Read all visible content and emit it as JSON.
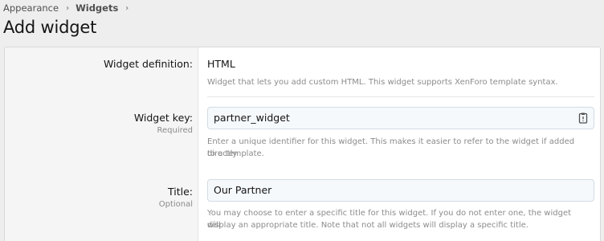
{
  "breadcrumb": {
    "items": [
      {
        "label": "Appearance"
      },
      {
        "label": "Widgets"
      }
    ]
  },
  "page_title": "Add widget",
  "form": {
    "definition": {
      "label": "Widget definition:",
      "value": "HTML",
      "hint": "Widget that lets you add custom HTML. This widget supports XenForo template syntax."
    },
    "widget_key": {
      "label": "Widget key:",
      "sublabel": "Required",
      "value": "partner_widget",
      "hint_line1": "Enter a unique identifier for this widget. This makes it easier to refer to the widget if added directly",
      "hint_line2": "to a template."
    },
    "title": {
      "label": "Title:",
      "sublabel": "Optional",
      "value": "Our Partner",
      "hint_line1": "You may choose to enter a specific title for this widget. If you do not enter one, the widget will",
      "hint_line2": "display an appropriate title. Note that not all widgets will display a specific title."
    }
  },
  "icons": {
    "breadcrumb_separator": "chevron-right-icon",
    "input_action": "clipboard-icon"
  }
}
